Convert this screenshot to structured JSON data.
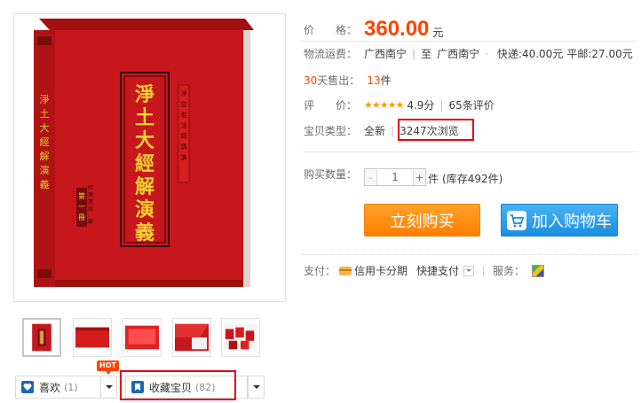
{
  "product": {
    "cover_title_chars": [
      "淨",
      "土",
      "大",
      "經",
      "解",
      "演",
      "義"
    ],
    "cover_tag": "[淨空老法師講演]",
    "cover_volume": "第一冊"
  },
  "price": {
    "label": "价　　格：",
    "value": "360.00",
    "unit": "元"
  },
  "shipping": {
    "label": "物流运费：",
    "from": "广西南宁",
    "to_prefix": "至",
    "to": "广西南宁",
    "express": "快递:40.00元",
    "mail": "平邮:27.00元"
  },
  "sales": {
    "days": "30",
    "label": "天售出：",
    "count": "13",
    "unit": "件"
  },
  "rating": {
    "label": "评　　价：",
    "stars": "★★★★★",
    "score": "4.9分",
    "reviews": "65条评价"
  },
  "item_type": {
    "label": "宝贝类型：",
    "condition": "全新",
    "views": "3247次浏览"
  },
  "quantity": {
    "label": "购买数量：",
    "value": "1",
    "minus": "–",
    "plus": "+",
    "unit": "件",
    "stock": "(库存492件)"
  },
  "actions": {
    "buy_now": "立刻购买",
    "add_to_cart": "加入购物车"
  },
  "payment": {
    "label": "支付：",
    "installment": "信用卡分期",
    "quick_pay": "快捷支付",
    "service_label": "服务："
  },
  "social": {
    "like_label": "喜欢",
    "like_count": "(1)",
    "hot_badge": "HOT",
    "favorite_label": "收藏宝贝",
    "favorite_count": "(82)"
  },
  "colors": {
    "price": "#ff4400",
    "buy_button": "#ff8a00",
    "cart_button": "#1a8fe2",
    "highlight_box": "#e60012",
    "book_red": "#c8161d"
  }
}
